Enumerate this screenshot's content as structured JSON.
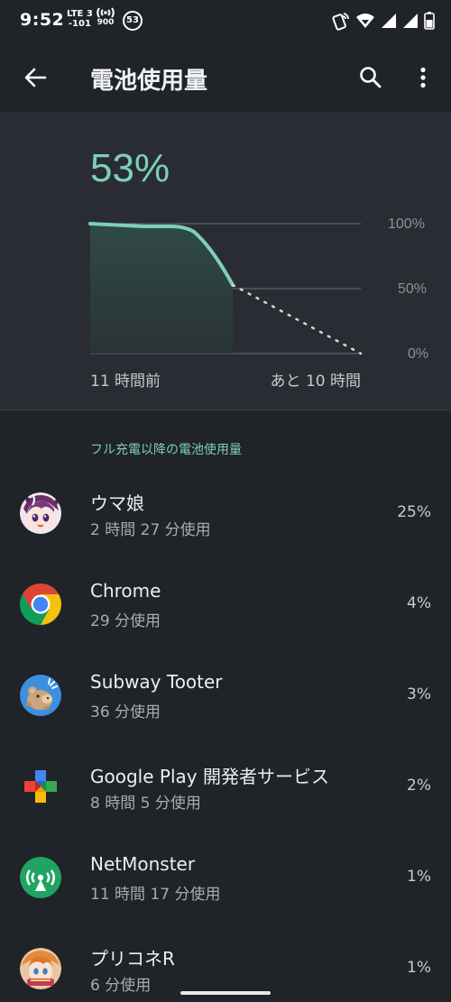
{
  "status_bar": {
    "time": "9:52",
    "lte_line1": "LTE 3",
    "lte_line2": "-101",
    "signal_freq": "900",
    "badge": "53"
  },
  "app_bar": {
    "title": "電池使用量",
    "back_icon": "arrow-back-icon",
    "search_icon": "search-icon",
    "more_icon": "more-vert-icon"
  },
  "battery": {
    "percent": "53%",
    "level": 0.53,
    "axis_labels": [
      "100%",
      "50%",
      "0%"
    ],
    "time_start": "11 時間前",
    "time_end": "あと 10 時間"
  },
  "section_header": "フル充電以降の電池使用量",
  "apps": [
    {
      "name": "ウマ娘",
      "usage": "2 時間 27 分使用",
      "percent": "25%",
      "icon": "umamusume-icon"
    },
    {
      "name": "Chrome",
      "usage": "29 分使用",
      "percent": "4%",
      "icon": "chrome-icon"
    },
    {
      "name": "Subway Tooter",
      "usage": "36 分使用",
      "percent": "3%",
      "icon": "subway-tooter-icon"
    },
    {
      "name": "Google Play 開発者サービス",
      "usage": "8 時間 5 分使用",
      "percent": "2%",
      "icon": "google-play-services-icon"
    },
    {
      "name": "NetMonster",
      "usage": "11 時間 17 分使用",
      "percent": "1%",
      "icon": "netmonster-icon"
    },
    {
      "name": "プリコネR",
      "usage": "6 分使用",
      "percent": "1%",
      "icon": "priconne-icon"
    }
  ],
  "colors": {
    "accent": "#7ecfbb",
    "background": "#202327",
    "card": "#292d33"
  }
}
